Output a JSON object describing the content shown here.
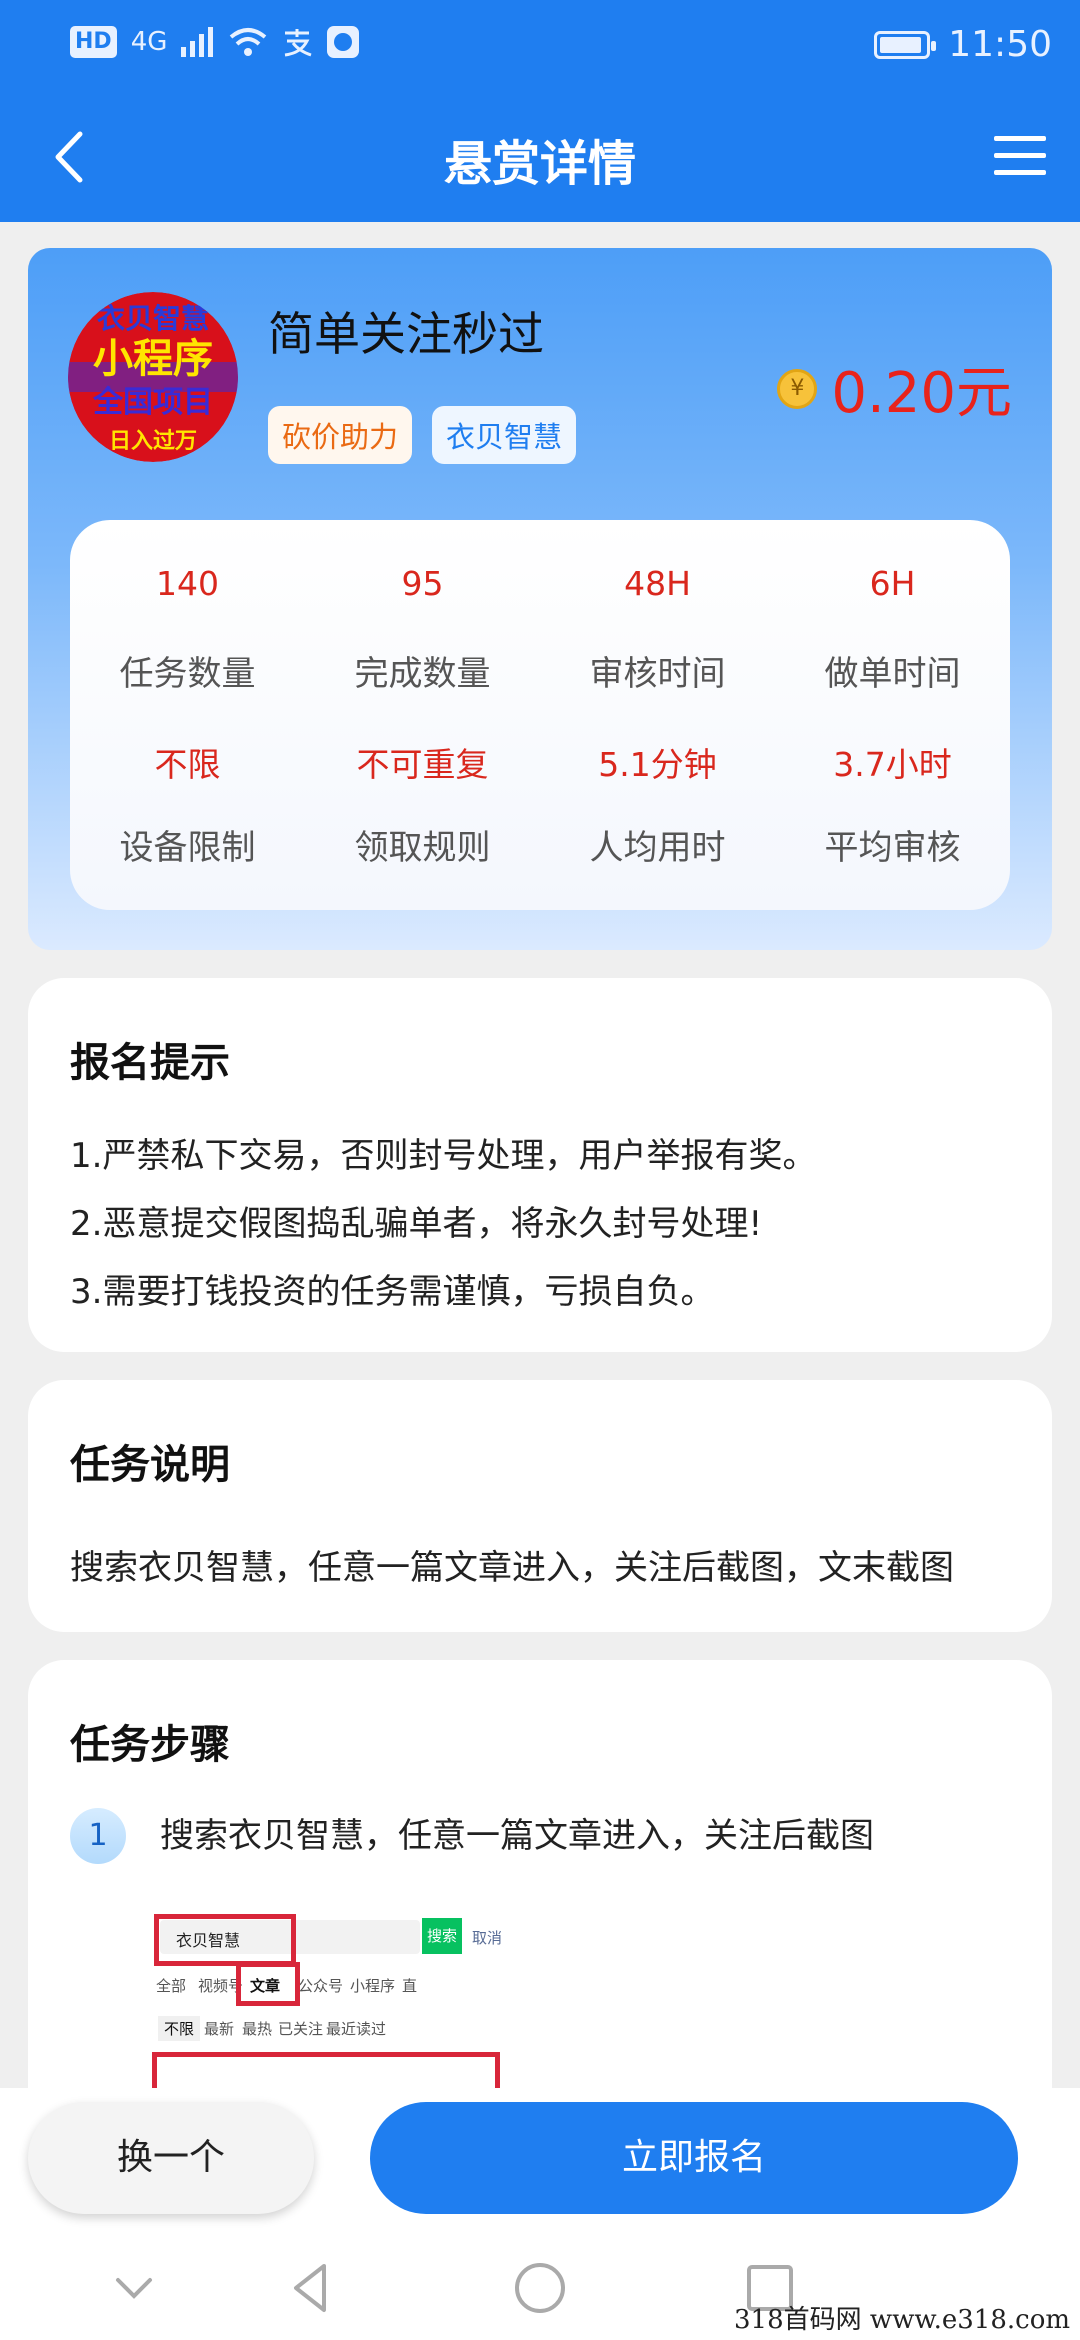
{
  "status_bar": {
    "left_chip": "HD",
    "network": "4G",
    "time": "11:50"
  },
  "header": {
    "title": "悬赏详情",
    "back_icon": "back-arrow-icon",
    "menu_icon": "hamburger-menu-icon"
  },
  "task": {
    "avatar_lines": [
      "衣贝智慧",
      "小程序",
      "全国项目",
      "日入过万"
    ],
    "title": "简单关注秒过",
    "tags": [
      "砍价助力",
      "衣贝智慧"
    ],
    "coin_symbol": "¥",
    "reward": "0.20元",
    "stats": [
      {
        "value": "140",
        "label": "任务数量"
      },
      {
        "value": "95",
        "label": "完成数量"
      },
      {
        "value": "48H",
        "label": "审核时间"
      },
      {
        "value": "6H",
        "label": "做单时间"
      },
      {
        "value": "不限",
        "label": "设备限制"
      },
      {
        "value": "不可重复",
        "label": "领取规则"
      },
      {
        "value": "5.1分钟",
        "label": "人均用时"
      },
      {
        "value": "3.7小时",
        "label": "平均审核"
      }
    ]
  },
  "signup_tips": {
    "title": "报名提示",
    "items": [
      "1.严禁私下交易，否则封号处理，用户举报有奖。",
      "2.恶意提交假图捣乱骗单者，将永久封号处理!",
      "3.需要打钱投资的任务需谨慎，亏损自负。"
    ]
  },
  "task_desc": {
    "title": "任务说明",
    "text": "搜索衣贝智慧，任意一篇文章进入，关注后截图，文末截图"
  },
  "task_steps": {
    "title": "任务步骤",
    "steps": [
      {
        "num": "1",
        "text": "搜索衣贝智慧，任意一篇文章进入，关注后截图"
      }
    ],
    "screenshot": {
      "search_value": "衣贝智慧",
      "search_btn": "搜索",
      "cancel": "取消",
      "tabs": [
        "全部",
        "视频号",
        "文章",
        "公众号",
        "小程序",
        "直"
      ],
      "filters": [
        "不限",
        "最新",
        "最热",
        "已关注",
        "最近读过"
      ]
    }
  },
  "bottom": {
    "switch_label": "换一个",
    "signup_label": "立即报名"
  },
  "watermark": "318首码网  www.e318.com",
  "colors": {
    "primary": "#1f7ef0",
    "red": "#e8231b",
    "orange_tag": "#ea6a13"
  }
}
